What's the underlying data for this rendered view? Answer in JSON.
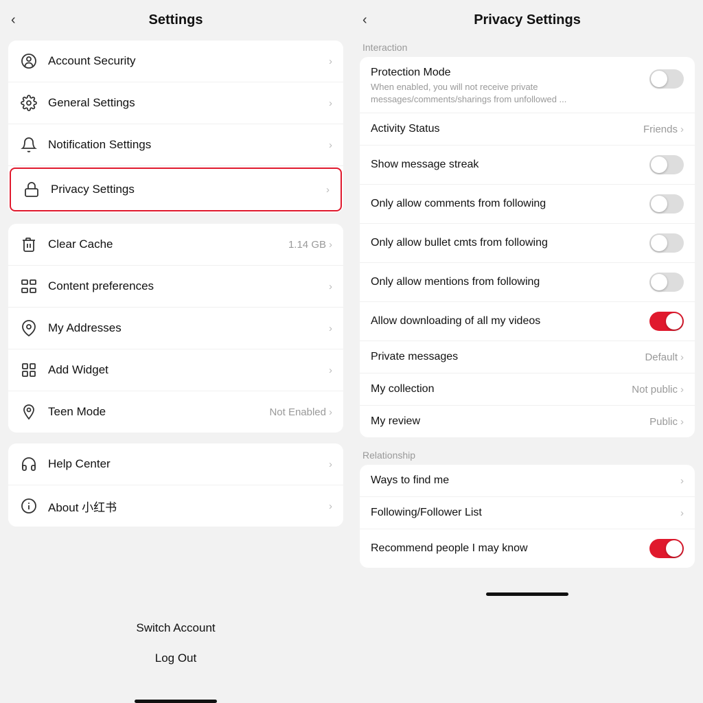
{
  "left": {
    "title": "Settings",
    "back_label": "‹",
    "groups": [
      {
        "id": "main-settings",
        "items": [
          {
            "id": "account-security",
            "label": "Account Security",
            "icon": "person-circle",
            "value": "",
            "highlighted": false
          },
          {
            "id": "general-settings",
            "label": "General Settings",
            "icon": "gear",
            "value": "",
            "highlighted": false
          },
          {
            "id": "notification-settings",
            "label": "Notification Settings",
            "icon": "bell",
            "value": "",
            "highlighted": false
          },
          {
            "id": "privacy-settings",
            "label": "Privacy Settings",
            "icon": "lock",
            "value": "",
            "highlighted": true
          }
        ]
      },
      {
        "id": "utility-settings",
        "items": [
          {
            "id": "clear-cache",
            "label": "Clear Cache",
            "icon": "trash",
            "value": "1.14 GB",
            "highlighted": false
          },
          {
            "id": "content-preferences",
            "label": "Content preferences",
            "icon": "content-pref",
            "value": "",
            "highlighted": false
          },
          {
            "id": "my-addresses",
            "label": "My Addresses",
            "icon": "location",
            "value": "",
            "highlighted": false
          },
          {
            "id": "add-widget",
            "label": "Add Widget",
            "icon": "widget",
            "value": "",
            "highlighted": false
          },
          {
            "id": "teen-mode",
            "label": "Teen Mode",
            "icon": "teen",
            "value": "Not Enabled",
            "highlighted": false
          }
        ]
      },
      {
        "id": "support-settings",
        "items": [
          {
            "id": "help-center",
            "label": "Help Center",
            "icon": "headset",
            "value": "",
            "highlighted": false
          },
          {
            "id": "about",
            "label": "About 小红书",
            "icon": "info",
            "value": "",
            "highlighted": false
          }
        ]
      }
    ],
    "actions": [
      {
        "id": "switch-account",
        "label": "Switch Account"
      },
      {
        "id": "log-out",
        "label": "Log Out"
      }
    ]
  },
  "right": {
    "title": "Privacy Settings",
    "back_label": "‹",
    "sections": [
      {
        "id": "interaction",
        "label": "Interaction",
        "items": [
          {
            "id": "protection-mode",
            "label": "Protection Mode",
            "sub": "When enabled, you will not receive private messages/comments/sharings from unfollowed ...",
            "type": "toggle",
            "value": "off"
          },
          {
            "id": "activity-status",
            "label": "Activity Status",
            "type": "link",
            "value": "Friends"
          },
          {
            "id": "show-message-streak",
            "label": "Show message streak",
            "type": "toggle",
            "value": "off"
          },
          {
            "id": "only-allow-comments",
            "label": "Only allow comments from following",
            "type": "toggle",
            "value": "off"
          },
          {
            "id": "only-allow-bullet",
            "label": "Only allow bullet cmts from following",
            "type": "toggle",
            "value": "off"
          },
          {
            "id": "only-allow-mentions",
            "label": "Only allow mentions from following",
            "type": "toggle",
            "value": "off"
          },
          {
            "id": "allow-downloading",
            "label": "Allow downloading of all my videos",
            "type": "toggle",
            "value": "on"
          },
          {
            "id": "private-messages",
            "label": "Private messages",
            "type": "link",
            "value": "Default"
          },
          {
            "id": "my-collection",
            "label": "My collection",
            "type": "link",
            "value": "Not public"
          },
          {
            "id": "my-review",
            "label": "My review",
            "type": "link",
            "value": "Public"
          }
        ]
      },
      {
        "id": "relationship",
        "label": "Relationship",
        "items": [
          {
            "id": "ways-to-find",
            "label": "Ways to find me",
            "type": "link",
            "value": ""
          },
          {
            "id": "following-follower-list",
            "label": "Following/Follower List",
            "type": "link",
            "value": ""
          },
          {
            "id": "recommend-people",
            "label": "Recommend people I may know",
            "type": "toggle",
            "value": "on"
          }
        ]
      }
    ]
  }
}
